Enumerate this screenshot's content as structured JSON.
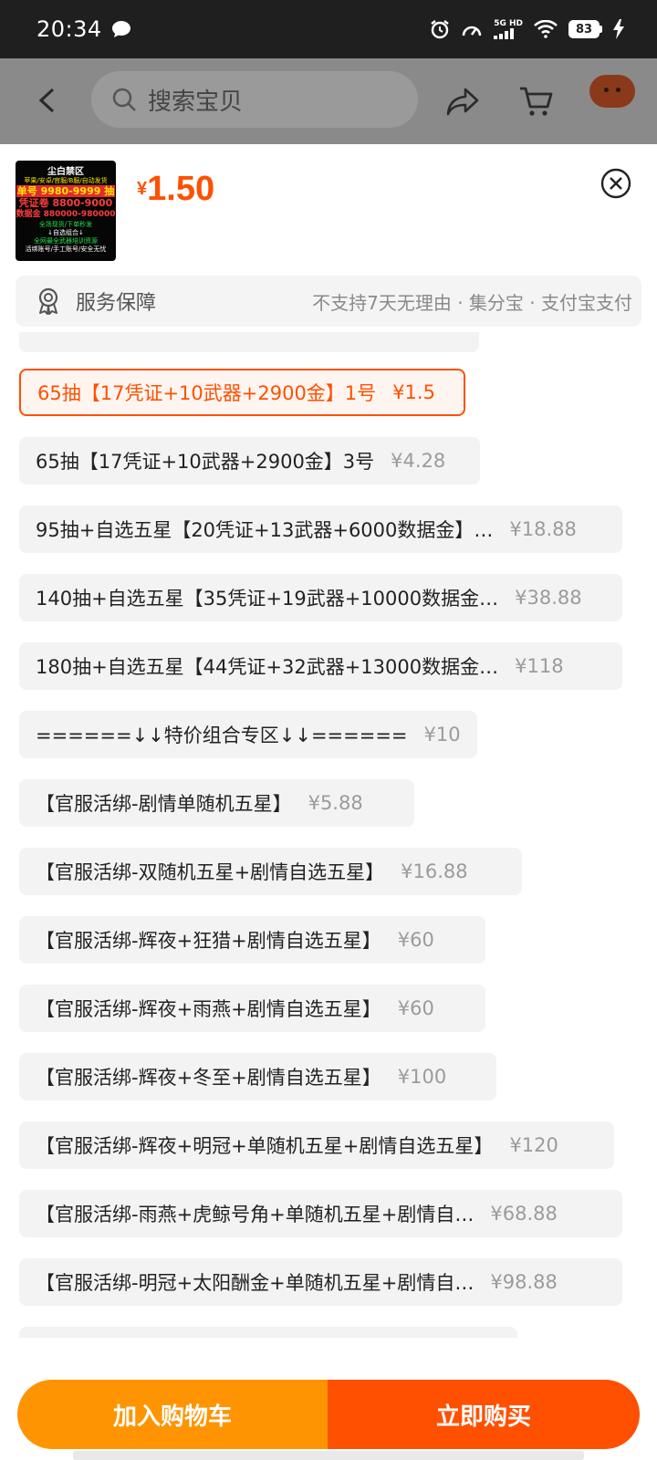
{
  "status_bar": {
    "time": "20:34",
    "network": "5G HD",
    "battery": "83"
  },
  "nav": {
    "search_placeholder": "搜索宝贝"
  },
  "product": {
    "price_symbol": "¥",
    "price": "1.50",
    "thumbnail": {
      "title": "尘白禁区",
      "lines": [
        "苹果/安卓/官服/B服/自动发货",
        "单号 9980-9999 抽",
        "凭证卷 8800-9000",
        "数据金 880000-980000",
        "全场现货/下单秒发",
        "↓自选组合↓",
        "全网最全武器培训资源",
        "活绑账号/手工账号/安全无忧"
      ]
    }
  },
  "service": {
    "label": "服务保障",
    "detail": "不支持7天无理由 · 集分宝 · 支付宝支付"
  },
  "options": [
    {
      "label": "65抽【17凭证+10武器+2900金】1号",
      "price": "¥1.5",
      "selected": true
    },
    {
      "label": "65抽【17凭证+10武器+2900金】3号",
      "price": "¥4.28",
      "selected": false
    },
    {
      "label": "95抽+自选五星【20凭证+13武器+6000数据金】…",
      "price": "¥18.88",
      "selected": false
    },
    {
      "label": "140抽+自选五星【35凭证+19武器+10000数据金…",
      "price": "¥38.88",
      "selected": false
    },
    {
      "label": " 180抽+自选五星【44凭证+32武器+13000数据金…",
      "price": "¥118",
      "selected": false
    },
    {
      "label": "======↓↓特价组合专区↓↓======",
      "price": "¥10",
      "selected": false
    },
    {
      "label": "【官服活绑-剧情单随机五星】",
      "price": "¥5.88",
      "selected": false
    },
    {
      "label": "【官服活绑-双随机五星+剧情自选五星】",
      "price": "¥16.88",
      "selected": false
    },
    {
      "label": "【官服活绑-辉夜+狂猎+剧情自选五星】",
      "price": "¥60",
      "selected": false
    },
    {
      "label": "【官服活绑-辉夜+雨燕+剧情自选五星】",
      "price": "¥60",
      "selected": false
    },
    {
      "label": "【官服活绑-辉夜+冬至+剧情自选五星】",
      "price": "¥100",
      "selected": false
    },
    {
      "label": "【官服活绑-辉夜+明冠+单随机五星+剧情自选五星】",
      "price": "¥120",
      "selected": false
    },
    {
      "label": " 【官服活绑-雨燕+虎鲸号角+单随机五星+剧情自…",
      "price": "¥68.88",
      "selected": false
    },
    {
      "label": " 【官服活绑-明冠+太阳酬金+单随机五星+剧情自…",
      "price": "¥98.88",
      "selected": false
    }
  ],
  "actions": {
    "add_to_cart": "加入购物车",
    "buy_now": "立即购买"
  },
  "colors": {
    "accent": "#ff5000",
    "cart_button": "#ff9402"
  }
}
